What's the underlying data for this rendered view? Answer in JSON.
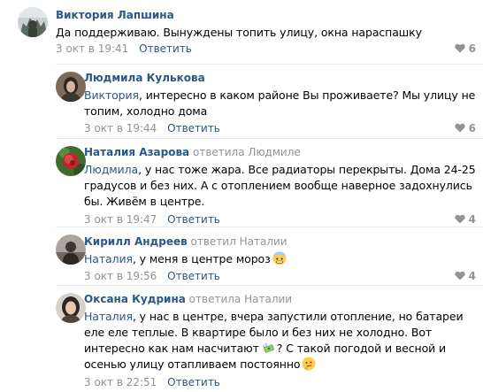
{
  "comments": [
    {
      "author": "Виктория Лапшина",
      "text": "Да поддерживаю. Вынуждены топить улицу, окна нараспашку",
      "date": "3 окт в 19:41",
      "reply_label": "Ответить",
      "likes": "6"
    },
    {
      "author": "Людмила Кулькова",
      "addressee": "Виктория",
      "text": ", интересно в каком районе Вы проживаете? Мы улицу не топим, холодно дома",
      "date": "3 окт в 19:44",
      "reply_label": "Ответить",
      "likes": "6"
    },
    {
      "author": "Наталия Азарова",
      "reply_note": "ответила",
      "reply_to": "Людмиле",
      "addressee": "Людмила",
      "text": ", у нас тоже жара. Все радиаторы перекрыты. Дома 24-25 градусов и без них. А с отоплением вообще наверное задохнулись бы. Живём в центре.",
      "date": "3 окт в 19:47",
      "reply_label": "Ответить",
      "likes": "4"
    },
    {
      "author": "Кирилл Андреев",
      "reply_note": "ответил",
      "reply_to": "Наталии",
      "addressee": "Наталия",
      "text": ", у меня в центре мороз",
      "emoji": "cold-face-emoji",
      "date": "3 окт в 19:56",
      "reply_label": "Ответить",
      "likes": "4"
    },
    {
      "author": "Оксана Кудрина",
      "reply_note": "ответила",
      "reply_to": "Наталии",
      "addressee": "Наталия",
      "text_part1": ", у нас в центре, вчера запустили отопление, но батареи еле еле теплые. В квартире было и без них не холодно. Вот интересно как нам насчитают",
      "emoji_mid": "money-with-wings-emoji",
      "text_part2": "? С такой погодой и весной и осенью улицу отапливаем постоянно",
      "emoji_end": "thinking-face-emoji",
      "date": "3 окт в 22:51",
      "reply_label": "Ответить"
    }
  ],
  "colors": {
    "link": "#2a5885",
    "muted": "#939393",
    "separator": "#e7e8ec"
  },
  "icons": {
    "like": "heart-icon"
  }
}
